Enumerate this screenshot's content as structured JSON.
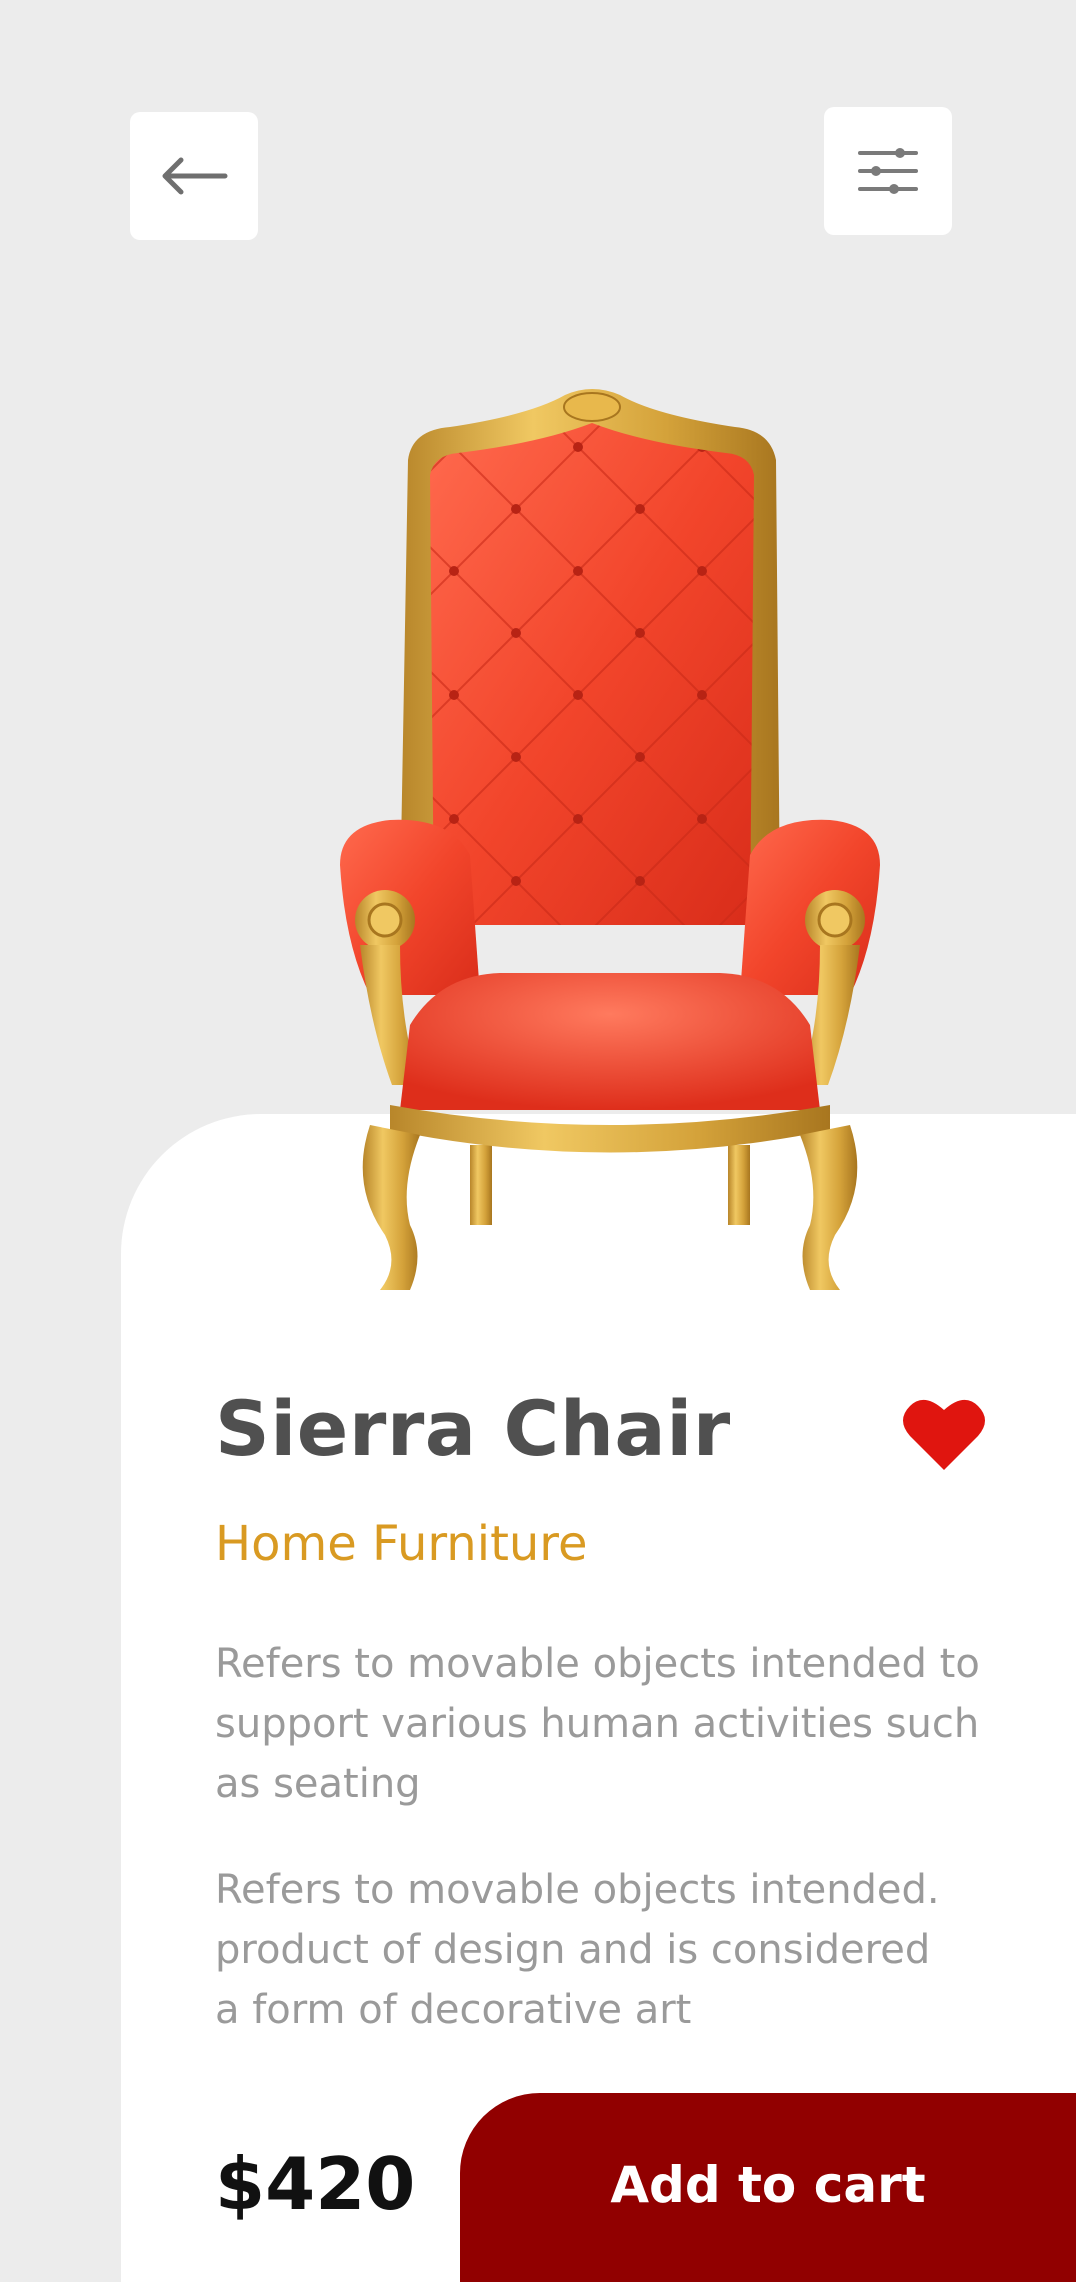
{
  "header": {
    "back_icon": "arrow-left-icon",
    "filter_icon": "sliders-icon"
  },
  "product": {
    "name": "Sierra Chair",
    "category": "Home Furniture",
    "description_1": "Refers to movable objects intended to support various human activities such as seating",
    "description_2": "Refers to movable objects intended. product of design and is considered a form of decorative art",
    "price": "$420",
    "favorite_icon": "heart-icon",
    "favorited": true
  },
  "actions": {
    "add_to_cart_label": "Add to cart"
  },
  "colors": {
    "background": "#ececec",
    "card": "#ffffff",
    "accent": "#910000",
    "category": "#d99a22",
    "heart": "#e0150f",
    "chair_upholstery": "#f2452b",
    "chair_frame": "#d4a23a"
  }
}
